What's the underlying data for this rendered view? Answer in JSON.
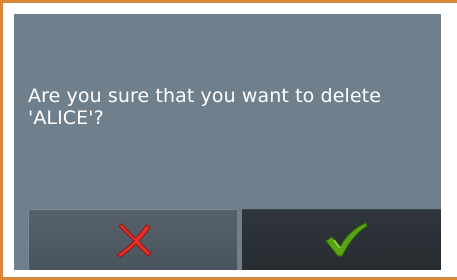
{
  "dialog": {
    "message": "Are you sure that you want to delete\n'ALICE'?",
    "cancel": {
      "icon": "red-x-icon",
      "color": "#e8302a"
    },
    "confirm": {
      "icon": "green-checkmark-icon",
      "color": "#5aa312"
    }
  },
  "colors": {
    "frame_border": "#d9883a",
    "dialog_background": "#6f7f8c",
    "text": "#ffffff"
  }
}
